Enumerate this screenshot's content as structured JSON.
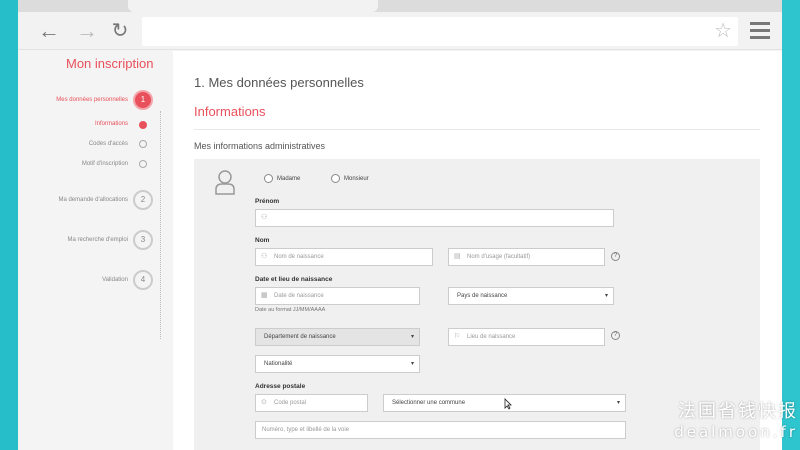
{
  "sidebar": {
    "title": "Mon inscription",
    "steps": [
      {
        "label": "Mes données personnelles",
        "number": "1"
      },
      {
        "label": "Ma demande d'allocations",
        "number": "2"
      },
      {
        "label": "Ma recherche d'emploi",
        "number": "3"
      },
      {
        "label": "Validation",
        "number": "4"
      }
    ],
    "substeps": [
      {
        "label": "Informations"
      },
      {
        "label": "Codes d'accès"
      },
      {
        "label": "Motif d'inscription"
      }
    ]
  },
  "main": {
    "section_title": "1. Mes données personnelles",
    "subsection_title": "Informations",
    "admin_title": "Mes informations administratives"
  },
  "form": {
    "civility": {
      "madame": "Madame",
      "monsieur": "Monsieur"
    },
    "prenom_label": "Prénom",
    "nom_label": "Nom",
    "nom_naissance_placeholder": "Nom de naissance",
    "nom_usage_placeholder": "Nom d'usage (facultatif)",
    "date_lieu_label": "Date et lieu de naissance",
    "date_placeholder": "Date de naissance",
    "date_hint": "Date au format JJ/MM/AAAA",
    "pays_select": "Pays de naissance",
    "departement_select": "Département de naissance",
    "lieu_placeholder": "Lieu de naissance",
    "nationalite_select": "Nationalité",
    "adresse_label": "Adresse postale",
    "code_postal_placeholder": "Code postal",
    "commune_select": "Sélectionner une commune",
    "voie_placeholder": "Numéro, type et libellé de la voie"
  },
  "colors": {
    "accent": "#e8505b",
    "frame": "#26bfc9"
  },
  "icons": [
    "back-arrow-icon",
    "forward-arrow-icon",
    "reload-icon",
    "star-icon",
    "hamburger-menu-icon",
    "user-icon",
    "calendar-icon",
    "location-pin-icon",
    "flag-icon",
    "help-icon"
  ],
  "watermark": {
    "line1": "法国省钱快报",
    "line2": "dealmoon.fr"
  }
}
